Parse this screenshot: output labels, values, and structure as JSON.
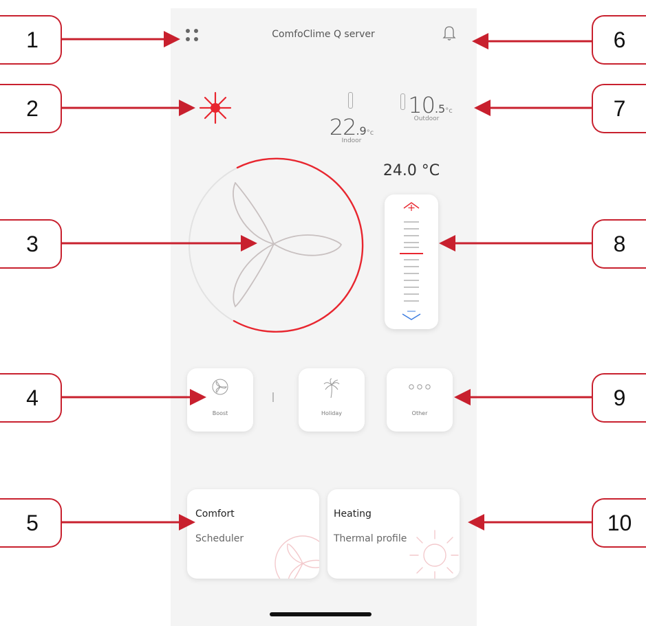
{
  "app": {
    "title": "ComfoClime Q server"
  },
  "header": {
    "menu_icon": "grid-dots-icon",
    "notification_icon": "bell-icon"
  },
  "status": {
    "icon": "sun-icon",
    "color": "#e8262f"
  },
  "temperatures": {
    "indoor": {
      "value": "22.9",
      "value_main": "22",
      "value_decimal": ".9",
      "unit": "°c",
      "label": "Indoor"
    },
    "outdoor": {
      "value": "10.5",
      "value_main": "10",
      "value_decimal": ".5",
      "unit": "°c",
      "label": "Outdoor"
    }
  },
  "setpoint": {
    "display": "24.0 °C"
  },
  "fan_dial": {
    "icon": "fan-icon"
  },
  "slider": {
    "up_icon": "chevron-up-icon",
    "down_icon": "chevron-down-icon"
  },
  "modes": [
    {
      "label": "Boost",
      "icon": "fan-boost-icon"
    },
    {
      "label": "Holiday",
      "icon": "palm-tree-icon"
    },
    {
      "label": "Other",
      "icon": "more-dots-icon"
    }
  ],
  "cards": {
    "comfort": {
      "title": "Comfort",
      "subtitle": "Scheduler",
      "icon": "fan-icon"
    },
    "heating": {
      "title": "Heating",
      "subtitle": "Thermal profile",
      "icon": "sun-outline-icon"
    }
  },
  "callouts": {
    "left": [
      "1",
      "2",
      "3",
      "4",
      "5"
    ],
    "right": [
      "6",
      "7",
      "8",
      "9",
      "10"
    ]
  },
  "colors": {
    "accent": "#e8262f",
    "callout_border": "#c8202e",
    "background": "#f4f4f4"
  }
}
